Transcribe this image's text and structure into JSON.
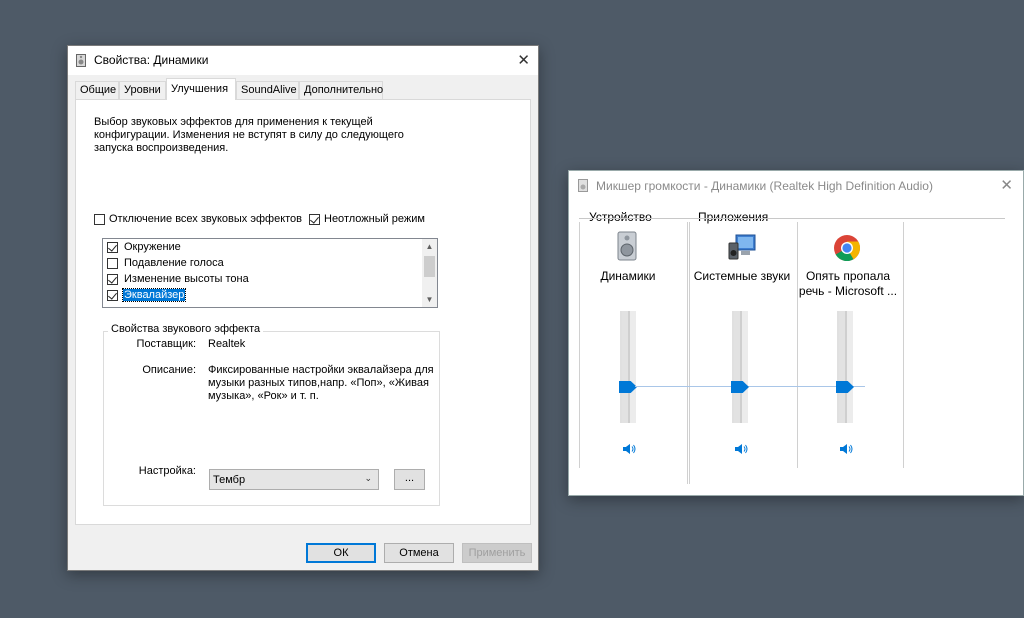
{
  "props_window": {
    "title": "Свойства: Динамики",
    "tabs": [
      "Общие",
      "Уровни",
      "Улучшения",
      "SoundAlive",
      "Дополнительно"
    ],
    "active_tab": "Улучшения",
    "description": "Выбор звуковых эффектов для применения к текущей\nконфигурации. Изменения не вступят в силу до следующего\nзапуска воспроизведения.",
    "disable_all_label": "Отключение всех звуковых эффектов",
    "disable_all_checked": false,
    "immediate_label": "Неотложный режим",
    "immediate_checked": true,
    "effects": [
      {
        "label": "Окружение",
        "checked": true
      },
      {
        "label": "Подавление голоса",
        "checked": false
      },
      {
        "label": "Изменение высоты тона",
        "checked": true
      },
      {
        "label": "Эквалайзер",
        "checked": true,
        "selected": true
      }
    ],
    "group_title": "Свойства звукового эффекта",
    "provider_label": "Поставщик:",
    "provider_value": "Realtek",
    "desc_label": "Описание:",
    "desc_value": "Фиксированные настройки эквалайзера для\nмузыки разных типов,напр. «Поп», «Живая\nмузыка», «Рок» и т. п.",
    "setting_label": "Настройка:",
    "setting_value": "Тембр",
    "dots_label": "...",
    "ok_label": "ОК",
    "cancel_label": "Отмена",
    "apply_label": "Применить"
  },
  "mixer_window": {
    "title": "Микшер громкости - Динамики (Realtek High Definition Audio)",
    "device_section": "Устройство",
    "apps_section": "Приложения",
    "channels": [
      {
        "name": "Динамики",
        "icon": "speaker-device-icon",
        "level": 0.5
      },
      {
        "name": "Системные звуки",
        "icon": "system-sounds-icon",
        "level": 0.5
      },
      {
        "name": "Опять пропала\nречь - Microsoft ...",
        "icon": "chrome-icon",
        "level": 0.5
      }
    ]
  },
  "colors": {
    "accent": "#0078d7",
    "desktop": "#4e5a67"
  }
}
